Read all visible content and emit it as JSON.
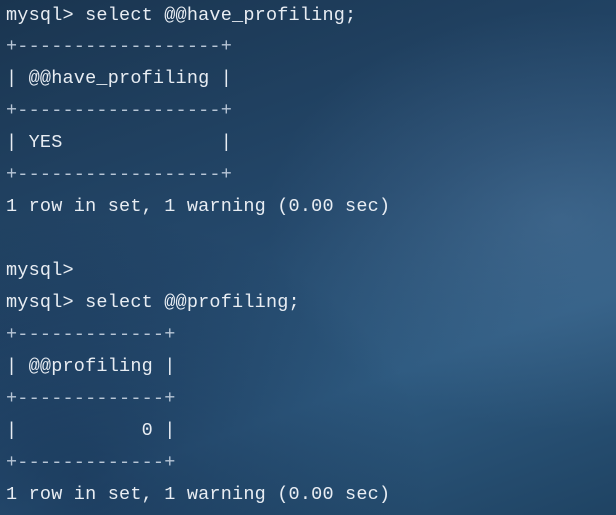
{
  "terminal": {
    "lines": [
      "mysql> select @@have_profiling;",
      "+------------------+",
      "| @@have_profiling |",
      "+------------------+",
      "| YES              |",
      "+------------------+",
      "1 row in set, 1 warning (0.00 sec)",
      "",
      "mysql>",
      "mysql> select @@profiling;",
      "+-------------+",
      "| @@profiling |",
      "+-------------+",
      "|           0 |",
      "+-------------+",
      "1 row in set, 1 warning (0.00 sec)"
    ]
  }
}
